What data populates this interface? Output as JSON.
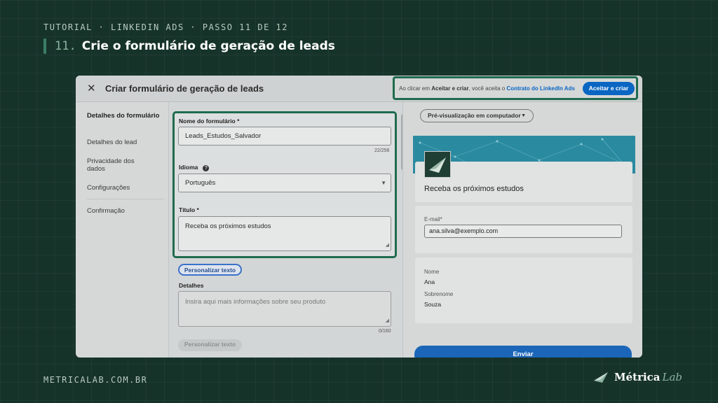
{
  "page": {
    "kicker": "TUTORIAL · LINKEDIN ADS · PASSO 11 DE 12",
    "step_number": "11.",
    "step_title": "Crie o formulário de geração de leads",
    "footer_url": "METRICALAB.COM.BR",
    "brand_name": "Métrica",
    "brand_suffix": "Lab"
  },
  "window": {
    "title": "Criar formulário de geração de leads",
    "close_icon": "close-icon",
    "accept_notice_prefix": "Ao clicar em ",
    "accept_notice_bold": "Aceitar e criar",
    "accept_notice_middle": ", você aceita o ",
    "accept_notice_link": "Contrato do LinkedIn Ads",
    "accept_button": "Aceitar e criar"
  },
  "sidebar": {
    "items": [
      {
        "label": "Detalhes do formulário",
        "active": true
      },
      {
        "label": "Detalhes do lead",
        "active": false
      },
      {
        "label": "Privacidade dos dados",
        "active": false
      },
      {
        "label": "Configurações",
        "active": false
      },
      {
        "label": "Confirmação",
        "active": false
      }
    ]
  },
  "form": {
    "name_label": "Nome do formulário *",
    "name_value": "Leads_Estudos_Salvador",
    "name_counter": "22/256",
    "language_label": "Idioma",
    "language_value": "Português",
    "title_label": "Título *",
    "title_value": "Receba os próximos estudos",
    "customize_button": "Personalizar texto",
    "details_label": "Detalhes",
    "details_placeholder": "Insira aqui mais informações sobre seu produto",
    "details_counter": "0/160",
    "customize_button_2": "Personalizar texto"
  },
  "preview": {
    "view_dropdown": "Pré-visualização em computador",
    "headline": "Receba os próximos estudos",
    "email_label": "E-mail*",
    "email_value": "ana.silva@exemplo.com",
    "first_name_label": "Nome",
    "first_name_value": "Ana",
    "last_name_label": "Sobrenome",
    "last_name_value": "Souza",
    "submit_button": "Enviar"
  },
  "colors": {
    "background": "#16332a",
    "highlight": "#1f6b4f",
    "linkedin_blue": "#0a66c2"
  }
}
